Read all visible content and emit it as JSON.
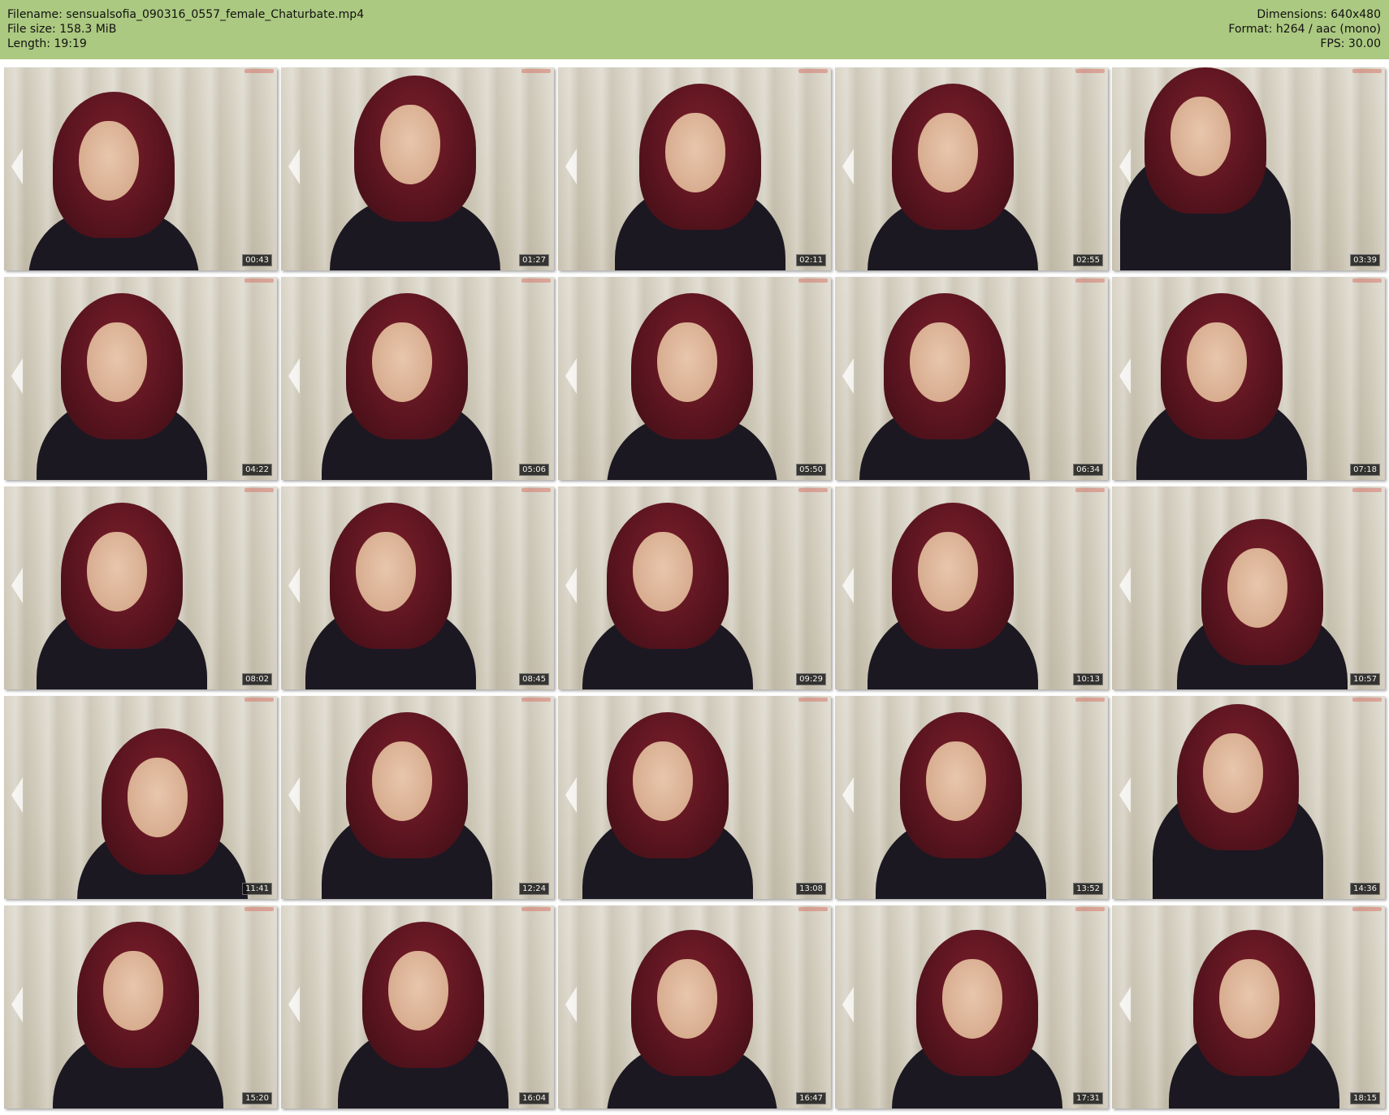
{
  "header": {
    "filename": "Filename: sensualsofia_090316_0557_female_Chaturbate.mp4",
    "filesize": "File size: 158.3 MiB",
    "length": "Length: 19:19",
    "dimensions": "Dimensions: 640x480",
    "format": "Format: h264 / aac (mono)",
    "fps": "FPS: 30.00"
  },
  "thumbnails": [
    {
      "timestamp": "00:43"
    },
    {
      "timestamp": "01:27"
    },
    {
      "timestamp": "02:11"
    },
    {
      "timestamp": "02:55"
    },
    {
      "timestamp": "03:39"
    },
    {
      "timestamp": "04:22"
    },
    {
      "timestamp": "05:06"
    },
    {
      "timestamp": "05:50"
    },
    {
      "timestamp": "06:34"
    },
    {
      "timestamp": "07:18"
    },
    {
      "timestamp": "08:02"
    },
    {
      "timestamp": "08:45"
    },
    {
      "timestamp": "09:29"
    },
    {
      "timestamp": "10:13"
    },
    {
      "timestamp": "10:57"
    },
    {
      "timestamp": "11:41"
    },
    {
      "timestamp": "12:24"
    },
    {
      "timestamp": "13:08"
    },
    {
      "timestamp": "13:52"
    },
    {
      "timestamp": "14:36"
    },
    {
      "timestamp": "15:20"
    },
    {
      "timestamp": "16:04"
    },
    {
      "timestamp": "16:47"
    },
    {
      "timestamp": "17:31"
    },
    {
      "timestamp": "18:15"
    }
  ]
}
